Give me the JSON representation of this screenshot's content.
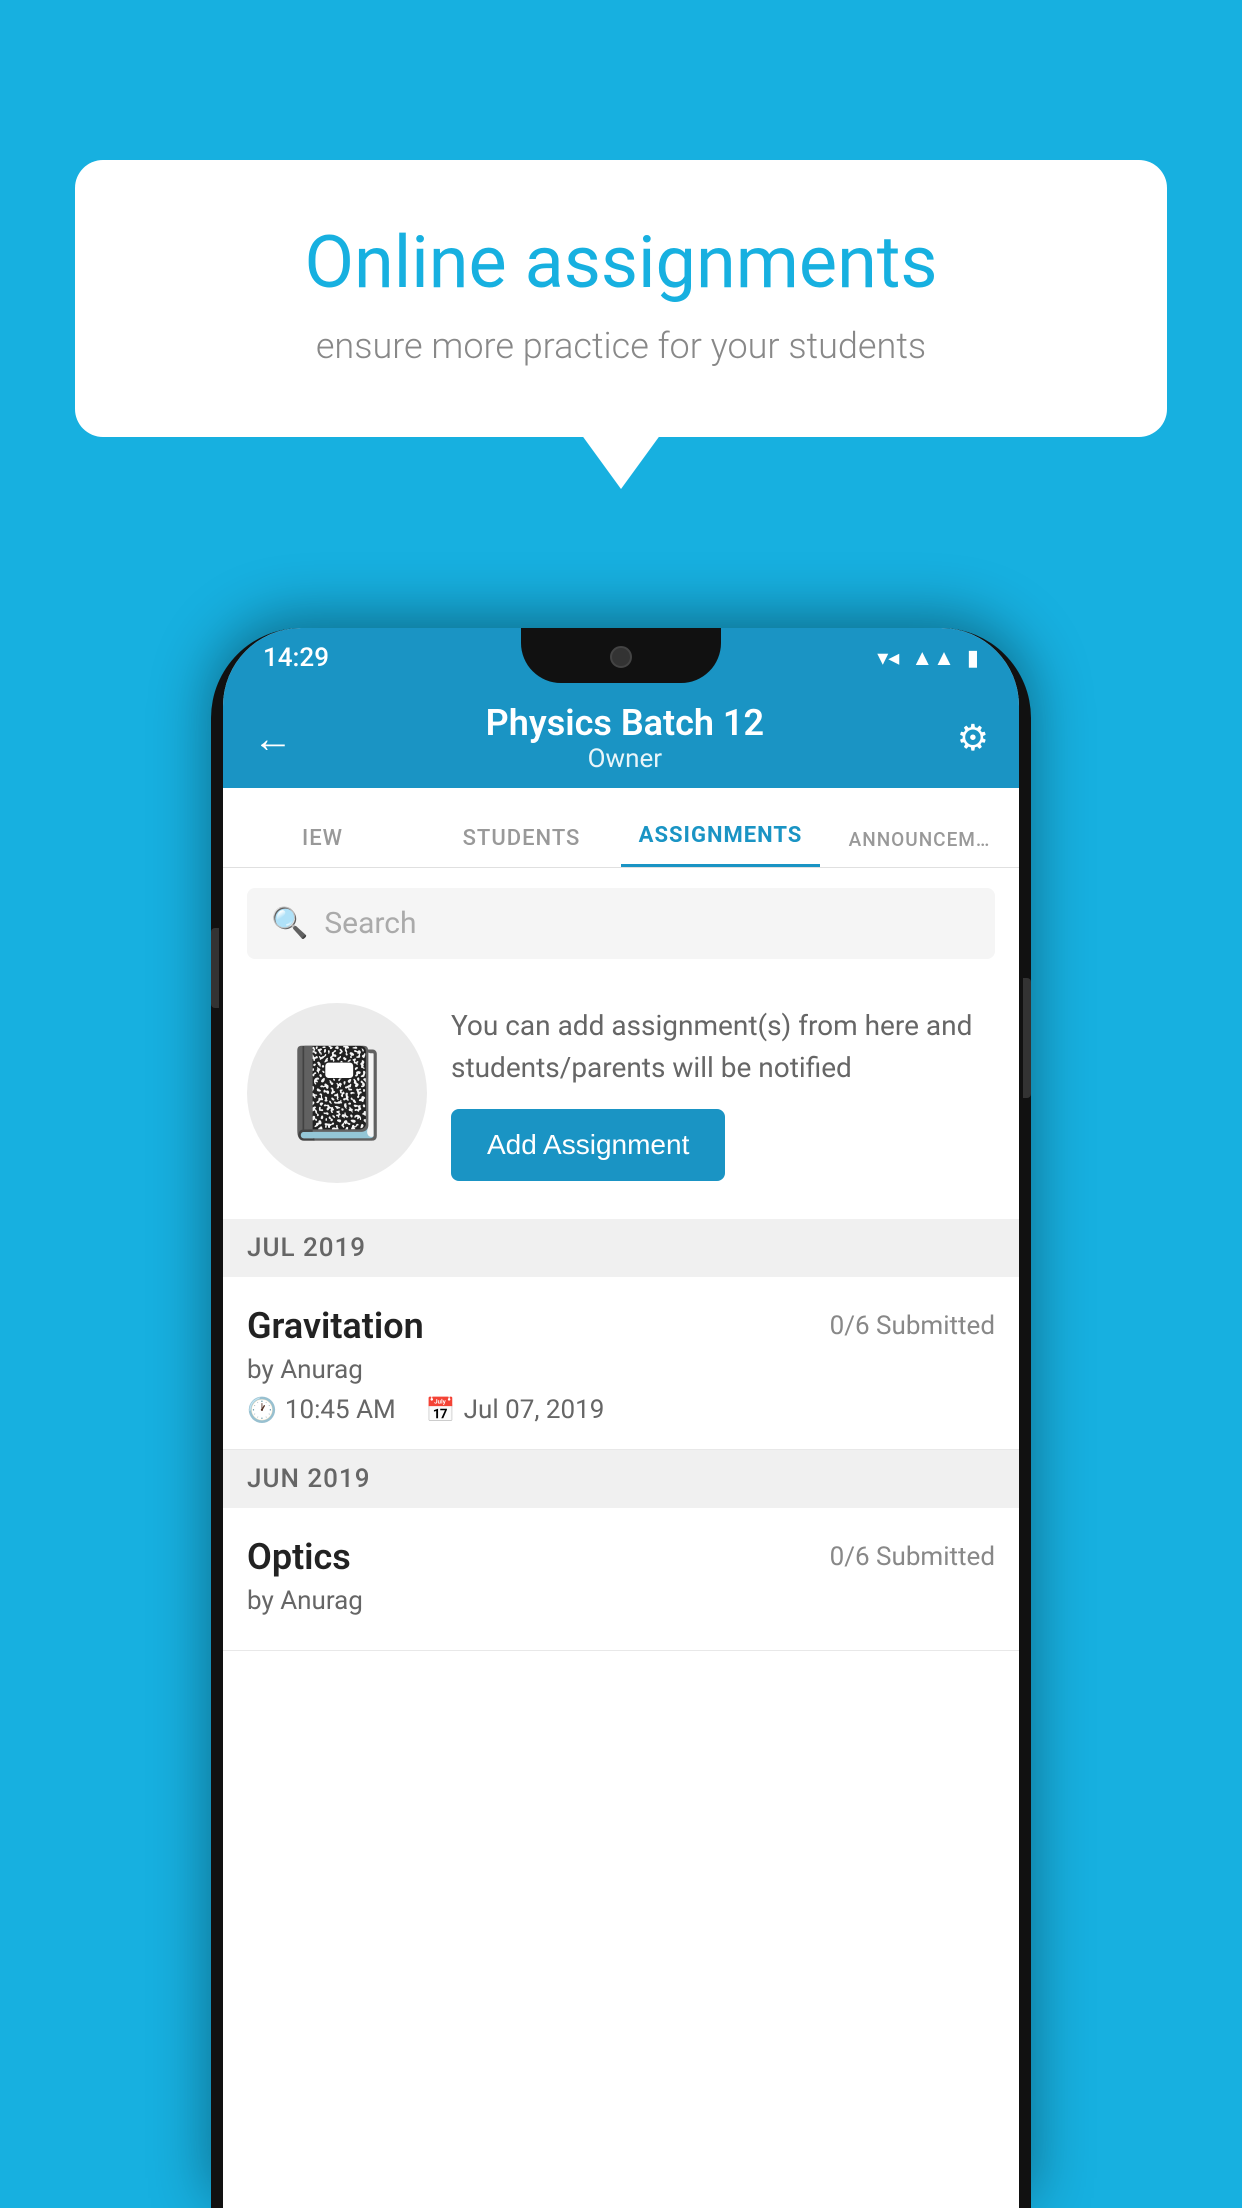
{
  "background_color": "#17b0e0",
  "bubble": {
    "title": "Online assignments",
    "subtitle": "ensure more practice for your students"
  },
  "status_bar": {
    "time": "14:29",
    "icons": [
      "wifi",
      "signal",
      "battery"
    ]
  },
  "header": {
    "title": "Physics Batch 12",
    "subtitle": "Owner",
    "back_label": "←",
    "settings_label": "⚙"
  },
  "tabs": [
    {
      "label": "IEW",
      "active": false
    },
    {
      "label": "STUDENTS",
      "active": false
    },
    {
      "label": "ASSIGNMENTS",
      "active": true
    },
    {
      "label": "ANNOUNCEM...",
      "active": false
    }
  ],
  "search": {
    "placeholder": "Search"
  },
  "promo": {
    "text": "You can add assignment(s) from here and students/parents will be notified",
    "button_label": "Add Assignment"
  },
  "sections": [
    {
      "month": "JUL 2019",
      "assignments": [
        {
          "name": "Gravitation",
          "submitted": "0/6 Submitted",
          "by": "by Anurag",
          "time": "10:45 AM",
          "date": "Jul 07, 2019"
        }
      ]
    },
    {
      "month": "JUN 2019",
      "assignments": [
        {
          "name": "Optics",
          "submitted": "0/6 Submitted",
          "by": "by Anurag",
          "time": "",
          "date": ""
        }
      ]
    }
  ]
}
